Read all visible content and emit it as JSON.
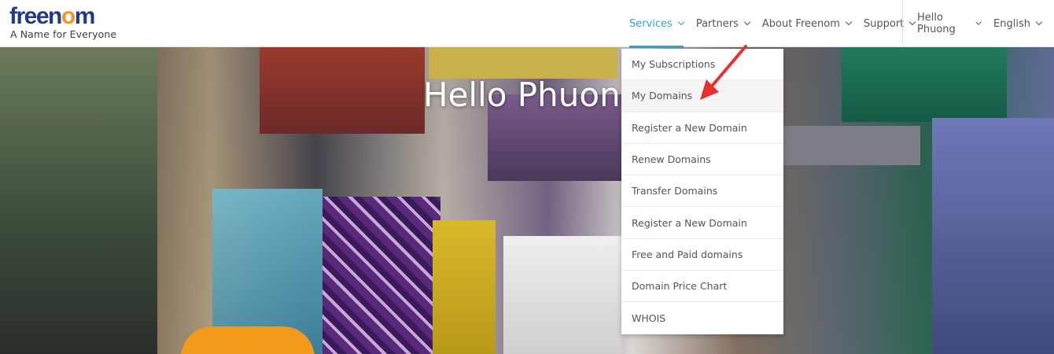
{
  "logo": {
    "part1": "free",
    "part2": "n",
    "part3": "o",
    "part4": "m",
    "tagline": "A Name for Everyone"
  },
  "nav": {
    "left": [
      {
        "label": "Services",
        "active": true
      },
      {
        "label": "Partners"
      },
      {
        "label": "About Freenom"
      },
      {
        "label": "Support"
      }
    ],
    "right": [
      {
        "label": "Hello Phuong"
      },
      {
        "label": "English"
      }
    ]
  },
  "hero": {
    "title": "Hello Phuong"
  },
  "dropdown": {
    "items": [
      "My Subscriptions",
      "My Domains",
      "Register a New Domain",
      "Renew Domains",
      "Transfer Domains",
      "Register a New Domain",
      "Free and Paid domains",
      "Domain Price Chart",
      "WHOIS"
    ]
  },
  "colors": {
    "brand_blue": "#1f3d84",
    "brand_orange": "#f6961f",
    "accent": "#3aa2d1",
    "arrow": "#e8312f"
  }
}
